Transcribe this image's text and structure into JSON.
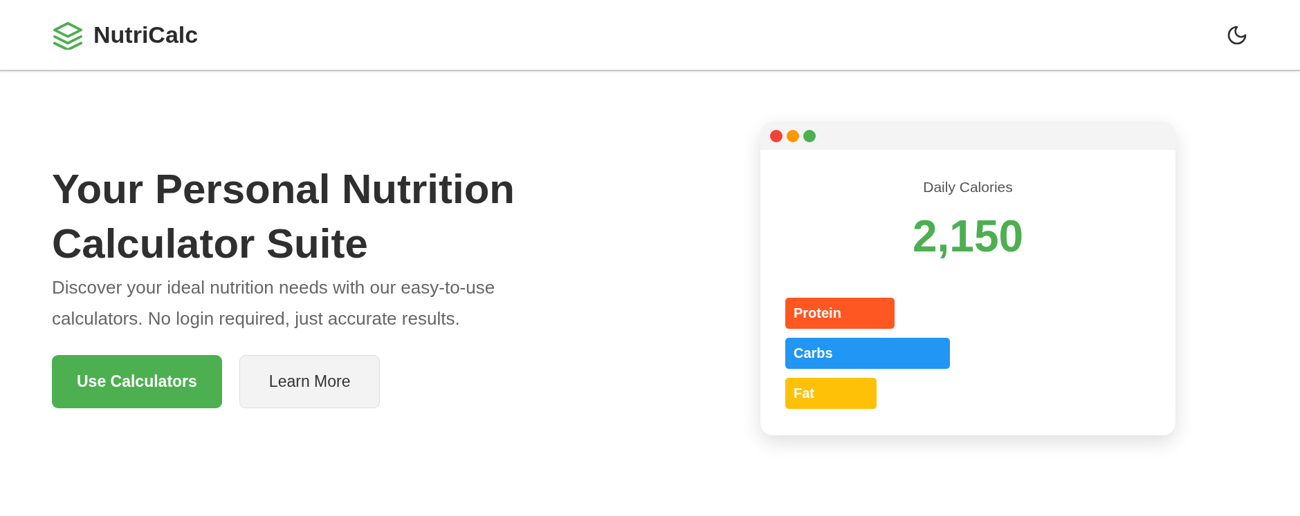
{
  "header": {
    "brand": "NutriCalc"
  },
  "hero": {
    "title": "Your Personal Nutrition Calculator Suite",
    "description": "Discover your ideal nutrition needs with our easy-to-use calculators. No login required, just accurate results.",
    "buttons": [
      {
        "label": "Use Calculators",
        "kind": "primary"
      },
      {
        "label": "Learn More",
        "kind": "secondary"
      }
    ]
  },
  "preview_card": {
    "window_dots": [
      {
        "color": "#f44336"
      },
      {
        "color": "#ff9800"
      },
      {
        "color": "#4caf50"
      }
    ],
    "label": "Daily Calories",
    "value": "2,150",
    "macros": [
      {
        "label": "Protein",
        "color": "#ff5722"
      },
      {
        "label": "Carbs",
        "color": "#2196f3"
      },
      {
        "label": "Fat",
        "color": "#ffc107"
      }
    ]
  }
}
